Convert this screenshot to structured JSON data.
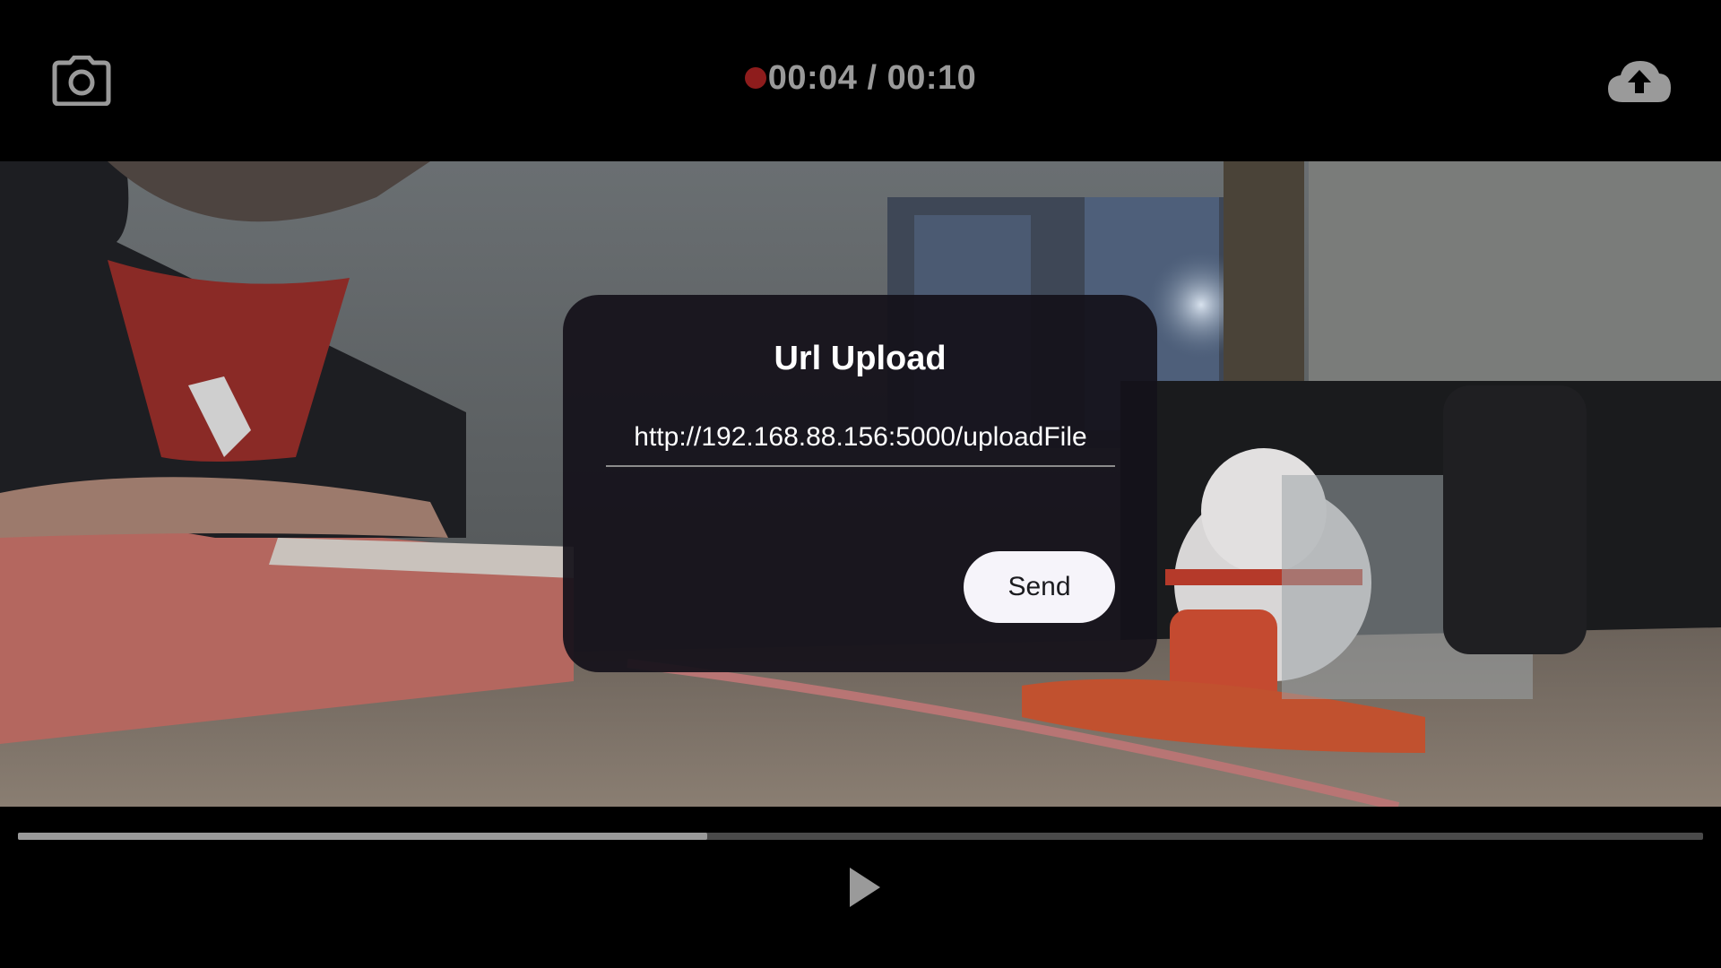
{
  "header": {
    "camera_icon": "camera-icon",
    "timer": {
      "recording_indicator_color": "#8e1c1c",
      "current_time": "00:04",
      "separator": " / ",
      "total_time": "00:10"
    },
    "upload_icon": "cloud-upload-icon"
  },
  "dialog": {
    "title": "Url Upload",
    "url_value": "http://192.168.88.156:5000/uploadFile",
    "send_label": "Send"
  },
  "playback": {
    "progress_fraction": 0.409,
    "play_icon": "play-icon"
  },
  "colors": {
    "background": "#000000",
    "dialog_background": "#14111a",
    "button_background": "#f6f4fa",
    "icon_gray": "#9a9a9a"
  }
}
